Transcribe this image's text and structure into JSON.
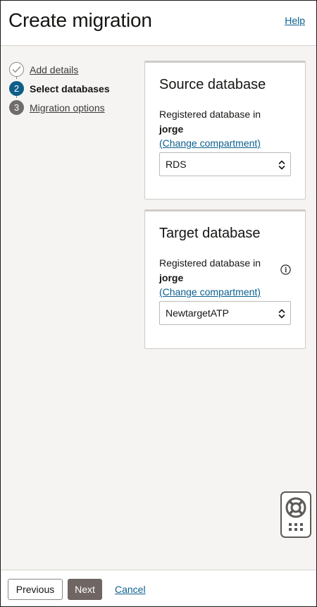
{
  "header": {
    "title": "Create migration",
    "help_label": "Help"
  },
  "steps": [
    {
      "number": "1",
      "label": "Add details",
      "state": "done"
    },
    {
      "number": "2",
      "label": "Select databases",
      "state": "active"
    },
    {
      "number": "3",
      "label": "Migration options",
      "state": "pending"
    }
  ],
  "source": {
    "title": "Source database",
    "field_label": "Registered database in",
    "compartment": "jorge",
    "change_label": "(Change compartment)",
    "selected": "RDS"
  },
  "target": {
    "title": "Target database",
    "field_label": "Registered database in",
    "compartment": "jorge",
    "change_label": "(Change compartment)",
    "selected": "NewtargetATP"
  },
  "footer": {
    "previous_label": "Previous",
    "next_label": "Next",
    "cancel_label": "Cancel"
  },
  "icons": {
    "step_done": "check-icon",
    "info": "info-icon",
    "select": "chevron-updown-icon",
    "help_widget": "lifebuoy-icon",
    "help_widget_grid": "grid-dots-icon"
  },
  "colors": {
    "link": "#0b5f8f",
    "active_step": "#0d5e88",
    "pending_step": "#6f6c69",
    "primary_button": "#6f6562",
    "background": "#f5f4f2"
  }
}
